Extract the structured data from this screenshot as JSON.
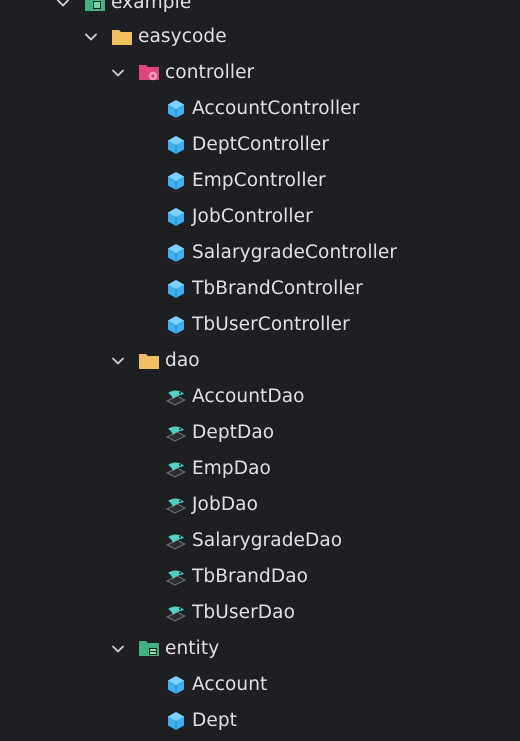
{
  "colors": {
    "background": "#1e1f22",
    "text": "#dfe1e5",
    "chevron": "#cfd1d6",
    "folder": "#f0c060",
    "controller_folder": "#e0457b",
    "entity_folder": "#3fb27f",
    "class_icon": "#3fb0f0",
    "dao_icon": "#4fd1c5"
  },
  "tree": {
    "root": {
      "label": "example",
      "icon": "package-folder-icon",
      "expanded": true
    },
    "package": {
      "label": "easycode",
      "icon": "folder-icon",
      "expanded": true
    },
    "controller": {
      "label": "controller",
      "icon": "controller-folder-icon",
      "expanded": true,
      "items": [
        {
          "label": "AccountController",
          "icon": "class-icon"
        },
        {
          "label": "DeptController",
          "icon": "class-icon"
        },
        {
          "label": "EmpController",
          "icon": "class-icon"
        },
        {
          "label": "JobController",
          "icon": "class-icon"
        },
        {
          "label": "SalarygradeController",
          "icon": "class-icon"
        },
        {
          "label": "TbBrandController",
          "icon": "class-icon"
        },
        {
          "label": "TbUserController",
          "icon": "class-icon"
        }
      ]
    },
    "dao": {
      "label": "dao",
      "icon": "folder-icon",
      "expanded": true,
      "items": [
        {
          "label": "AccountDao",
          "icon": "mapper-icon"
        },
        {
          "label": "DeptDao",
          "icon": "mapper-icon"
        },
        {
          "label": "EmpDao",
          "icon": "mapper-icon"
        },
        {
          "label": "JobDao",
          "icon": "mapper-icon"
        },
        {
          "label": "SalarygradeDao",
          "icon": "mapper-icon"
        },
        {
          "label": "TbBrandDao",
          "icon": "mapper-icon"
        },
        {
          "label": "TbUserDao",
          "icon": "mapper-icon"
        }
      ]
    },
    "entity": {
      "label": "entity",
      "icon": "entity-folder-icon",
      "expanded": true,
      "items": [
        {
          "label": "Account",
          "icon": "class-icon"
        },
        {
          "label": "Dept",
          "icon": "class-icon"
        }
      ]
    }
  }
}
